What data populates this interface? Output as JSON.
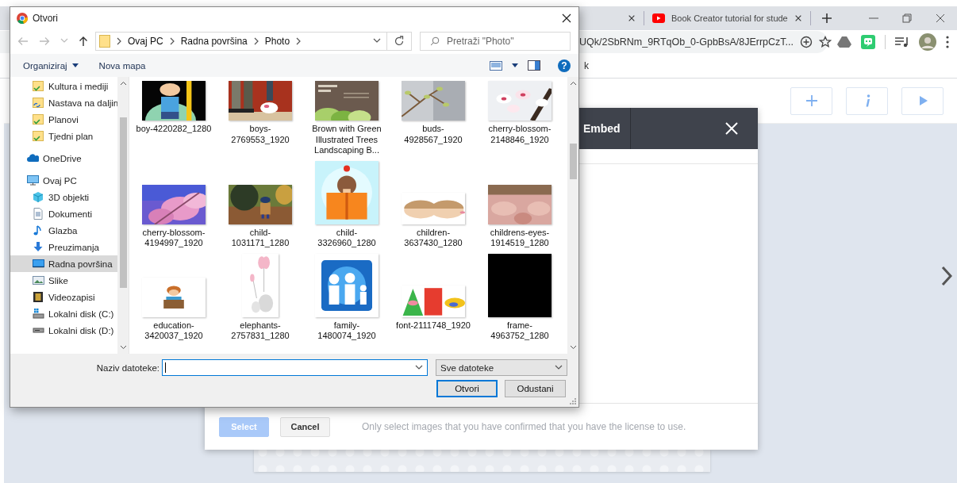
{
  "browser": {
    "tabs": [
      {
        "title": "Book Creator tutorial for stude"
      }
    ],
    "address": "UQk/2SbRNm_9RTqOb_0-GpbBsA/8JErrpCzT...",
    "bookmark": "k"
  },
  "page": {
    "tools": [
      {
        "kind": "add"
      },
      {
        "kind": "info"
      },
      {
        "kind": "play"
      }
    ],
    "modal": {
      "tab": "Embed",
      "select": {
        "label": "Select",
        "disabled": true
      },
      "cancel": "Cancel",
      "note": "Only select images that you have confirmed that you have the license to use."
    }
  },
  "dialog": {
    "title": "Otvori",
    "path": [
      "Ovaj PC",
      "Radna površina",
      "Photo"
    ],
    "search_placeholder": "Pretraži \"Photo\"",
    "toolbar": [
      {
        "label": "Organiziraj",
        "menu": true
      },
      {
        "label": "Nova mapa",
        "menu": false
      }
    ],
    "help": "?",
    "nav": [
      {
        "children": [
          {
            "label": "Kultura i mediji",
            "selected": false
          },
          {
            "label": "Nastava na daljin",
            "selected": false
          },
          {
            "label": "Planovi",
            "selected": false
          },
          {
            "label": "Tjedni plan",
            "selected": false
          }
        ]
      },
      {
        "label": "OneDrive",
        "selected": false
      },
      {
        "label": "Ovaj PC",
        "selected": false,
        "children": [
          {
            "label": "3D objekti",
            "selected": false
          },
          {
            "label": "Dokumenti",
            "selected": false
          },
          {
            "label": "Glazba",
            "selected": false
          },
          {
            "label": "Preuzimanja",
            "selected": false
          },
          {
            "label": "Radna površina",
            "selected": true
          },
          {
            "label": "Slike",
            "selected": false
          },
          {
            "label": "Videozapisi",
            "selected": false
          },
          {
            "label": "Lokalni disk (C:)",
            "selected": false
          },
          {
            "label": "Lokalni disk (D:)",
            "selected": false
          }
        ]
      }
    ],
    "files": [
      {
        "name": "boy-4220282_1280"
      },
      {
        "name": "boys-2769553_1920"
      },
      {
        "name": "Brown with Green Illustrated Trees Landscaping B..."
      },
      {
        "name": "buds-4928567_1920"
      },
      {
        "name": "cherry-blossom-2148846_1920"
      },
      {
        "name": "cherry-blossom-4194997_1920"
      },
      {
        "name": "child-1031171_1280"
      },
      {
        "name": "child-3326960_1280"
      },
      {
        "name": "children-3637430_1280"
      },
      {
        "name": "childrens-eyes-1914519_1280"
      },
      {
        "name": "education-3420037_1920"
      },
      {
        "name": "elephants-2757831_1280"
      },
      {
        "name": "family-1480074_1920"
      },
      {
        "name": "font-2111748_1920"
      },
      {
        "name": "frame-4963752_1280"
      }
    ],
    "filename_label": "Naziv datoteke:",
    "filename_focused": true,
    "file_type": "Sve datoteke",
    "buttons": [
      {
        "label": "Otvori",
        "default": true
      },
      {
        "label": "Odustani",
        "default": false
      }
    ]
  }
}
